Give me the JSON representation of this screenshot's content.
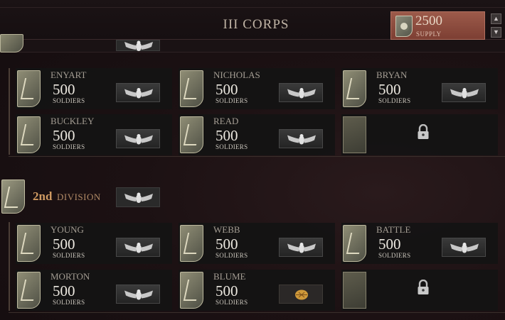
{
  "header": {
    "title": "III CORPS",
    "supply_value": "2500",
    "supply_label": "SUPPLY",
    "scroll_up_icon": "▲",
    "scroll_down_icon": "▼"
  },
  "division_2": {
    "number": "2nd",
    "label": "DIVISION"
  },
  "division_1_brigades": [
    {
      "name": "ENYART",
      "soldiers": "500",
      "unit": "SOLDIERS",
      "icon": "eagle-icon"
    },
    {
      "name": "NICHOLAS",
      "soldiers": "500",
      "unit": "SOLDIERS",
      "icon": "eagle-icon"
    },
    {
      "name": "BRYAN",
      "soldiers": "500",
      "unit": "SOLDIERS",
      "icon": "eagle-icon"
    },
    {
      "name": "BUCKLEY",
      "soldiers": "500",
      "unit": "SOLDIERS",
      "icon": "eagle-icon"
    },
    {
      "name": "READ",
      "soldiers": "500",
      "unit": "SOLDIERS",
      "icon": "eagle-icon"
    }
  ],
  "division_2_brigades": [
    {
      "name": "YOUNG",
      "soldiers": "500",
      "unit": "SOLDIERS",
      "icon": "eagle-icon"
    },
    {
      "name": "WEBB",
      "soldiers": "500",
      "unit": "SOLDIERS",
      "icon": "eagle-icon"
    },
    {
      "name": "BATTLE",
      "soldiers": "500",
      "unit": "SOLDIERS",
      "icon": "eagle-icon"
    },
    {
      "name": "MORTON",
      "soldiers": "500",
      "unit": "SOLDIERS",
      "icon": "eagle-icon"
    },
    {
      "name": "BLUME",
      "soldiers": "500",
      "unit": "SOLDIERS",
      "icon": "leaf-icon"
    }
  ],
  "colors": {
    "division_number": "#cf9a62",
    "supply_bg": "#8c4d40",
    "leaf_icon": "#d09a3a"
  }
}
